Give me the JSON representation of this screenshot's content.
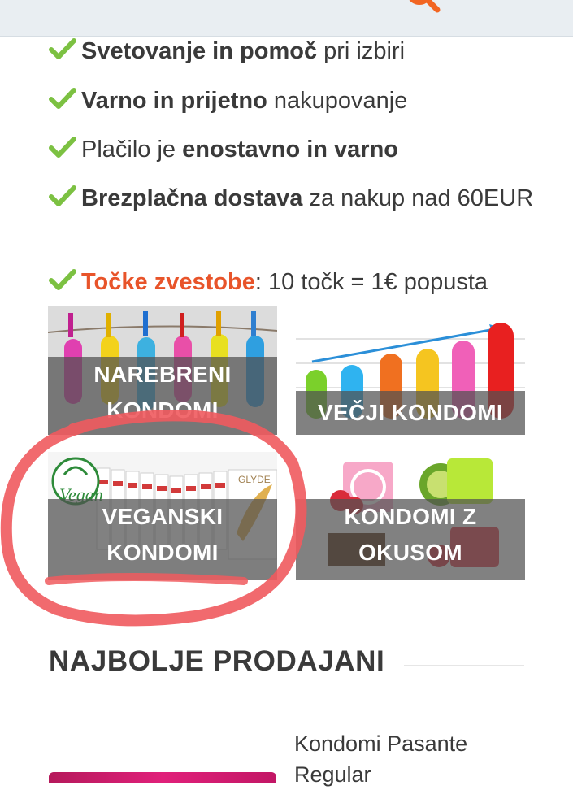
{
  "header": {
    "search_icon": "search-icon",
    "accent_color": "#e8542a"
  },
  "features": [
    {
      "bold": "Svetovanje in pomoč",
      "rest": " pri izbiri"
    },
    {
      "bold": "Varno in prijetno",
      "rest": " nakupovanje"
    },
    {
      "pre": "Plačilo je ",
      "bold": "enostavno in varno"
    },
    {
      "bold": "Brezplačna dostava",
      "rest": " za nakup nad 60EUR"
    },
    {
      "accent": "Točke zvestobe",
      "rest": ": 10 točk = 1€ popusta"
    }
  ],
  "categories": [
    {
      "line1": "NAREBRENI",
      "line2": "KONDOMI"
    },
    {
      "line1": "VEČJI KONDOMI"
    },
    {
      "line1": "VEGANSKI",
      "line2": "KONDOMI",
      "logo_text": "Vegan",
      "brand_text": "GLYDE"
    },
    {
      "line1": "KONDOMI Z",
      "line2": "OKUSOM"
    }
  ],
  "bestsellers": {
    "title": "NAJBOLJE PRODAJANI",
    "products": [
      {
        "name": "Kondomi Pasante Regular"
      }
    ]
  },
  "colors": {
    "check": "#7cc142",
    "annotation": "#f05a5e",
    "overlay": "#505050"
  }
}
